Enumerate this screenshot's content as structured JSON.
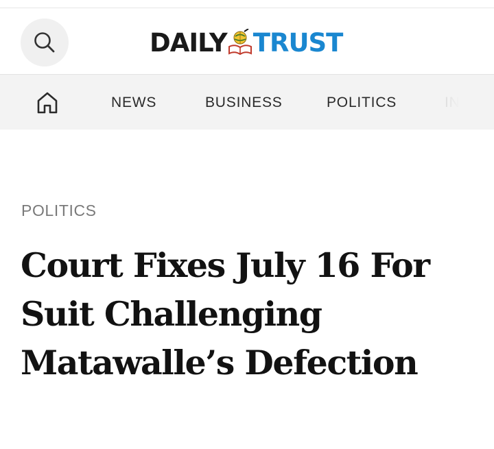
{
  "header": {
    "logo_daily": "DAILY",
    "logo_trust": "TRUST",
    "search_icon": "search-icon",
    "colors": {
      "brand_dark": "#1a1a1a",
      "brand_blue": "#1a87d0"
    }
  },
  "nav": {
    "home_icon": "home-icon",
    "items": [
      {
        "label": "NEWS"
      },
      {
        "label": "BUSINESS"
      },
      {
        "label": "POLITICS"
      },
      {
        "label": "IN"
      }
    ]
  },
  "article": {
    "section": "POLITICS",
    "headline": "Court Fixes July 16 For Suit Challenging Matawalle’s Defection"
  }
}
